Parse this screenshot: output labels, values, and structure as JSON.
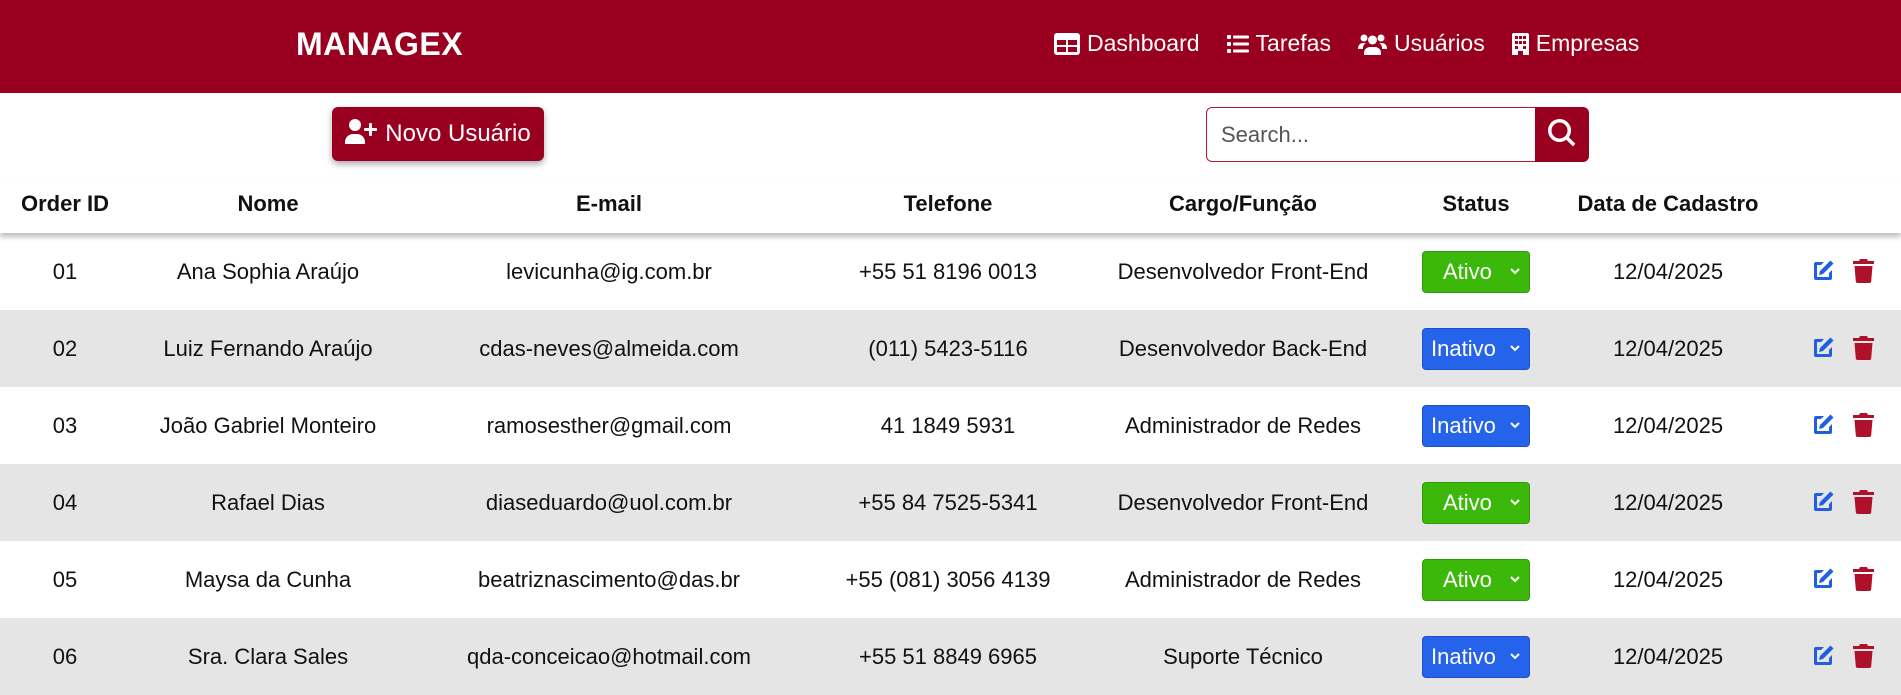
{
  "brand": "MANAGEX",
  "nav": [
    {
      "label": "Dashboard",
      "icon": "dashboard-icon"
    },
    {
      "label": "Tarefas",
      "icon": "list-icon"
    },
    {
      "label": "Usuários",
      "icon": "users-icon"
    },
    {
      "label": "Empresas",
      "icon": "building-icon"
    }
  ],
  "toolbar": {
    "new_user_label": "Novo Usuário",
    "search_placeholder": "Search...",
    "search_value": ""
  },
  "table": {
    "headers": [
      "Order ID",
      "Nome",
      "E-mail",
      "Telefone",
      "Cargo/Função",
      "Status",
      "Data de Cadastro"
    ],
    "rows": [
      {
        "id": "01",
        "nome": "Ana Sophia Araújo",
        "email": "levicunha@ig.com.br",
        "telefone": "+55 51 8196 0013",
        "cargo": "Desenvolvedor Front-End",
        "status": "Ativo",
        "data": "12/04/2025"
      },
      {
        "id": "02",
        "nome": "Luiz Fernando Araújo",
        "email": "cdas-neves@almeida.com",
        "telefone": "(011) 5423-5116",
        "cargo": "Desenvolvedor Back-End",
        "status": "Inativo",
        "data": "12/04/2025"
      },
      {
        "id": "03",
        "nome": "João Gabriel Monteiro",
        "email": "ramosesther@gmail.com",
        "telefone": "41 1849 5931",
        "cargo": "Administrador de Redes",
        "status": "Inativo",
        "data": "12/04/2025"
      },
      {
        "id": "04",
        "nome": "Rafael Dias",
        "email": "diaseduardo@uol.com.br",
        "telefone": "+55 84 7525-5341",
        "cargo": "Desenvolvedor Front-End",
        "status": "Ativo",
        "data": "12/04/2025"
      },
      {
        "id": "05",
        "nome": "Maysa da Cunha",
        "email": "beatriznascimento@das.br",
        "telefone": "+55 (081) 3056 4139",
        "cargo": "Administrador de Redes",
        "status": "Ativo",
        "data": "12/04/2025"
      },
      {
        "id": "06",
        "nome": "Sra. Clara Sales",
        "email": "qda-conceicao@hotmail.com",
        "telefone": "+55 51 8849 6965",
        "cargo": "Suporte Técnico",
        "status": "Inativo",
        "data": "12/04/2025"
      }
    ]
  },
  "colors": {
    "brand": "#990020",
    "status_active": "#3cb80b",
    "status_inactive": "#2563eb",
    "edit_icon": "#1f5fe0",
    "delete_icon": "#b0112a",
    "row_alt": "#e5e5e5"
  }
}
